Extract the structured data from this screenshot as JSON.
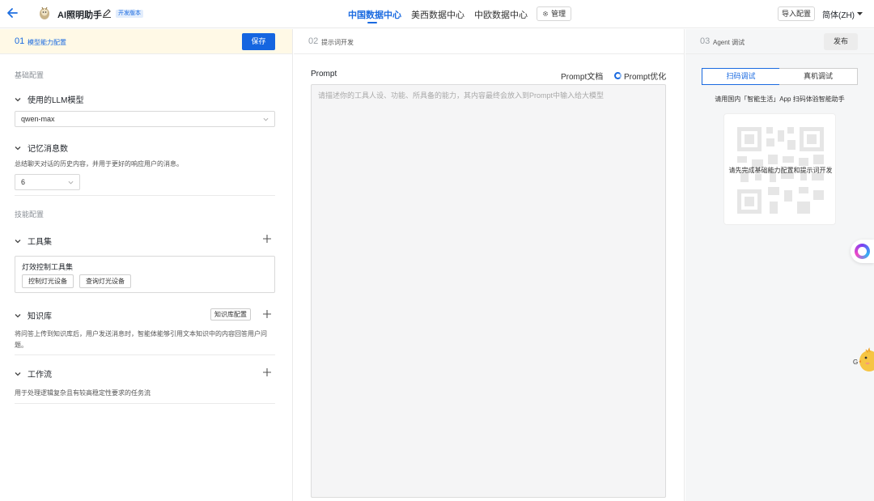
{
  "header": {
    "app_name": "AI照明助手",
    "badge": "开发版本",
    "tabs": [
      {
        "label": "中国数据中心",
        "active": true
      },
      {
        "label": "美西数据中心",
        "active": false
      },
      {
        "label": "中欧数据中心",
        "active": false
      }
    ],
    "manage_label": "管理",
    "import_label": "导入配置",
    "language": "简体(ZH)",
    "accent_color": "#1a6ae0"
  },
  "left": {
    "step": "01",
    "title": "模型能力配置",
    "save_label": "保存",
    "basic_section": "基础配置",
    "llm_label": "使用的LLM模型",
    "llm_value": "qwen-max",
    "memory_label": "记忆消息数",
    "memory_hint": "总结聊天对话的历史内容，并用于更好的响应用户的消息。",
    "memory_value": "6",
    "skill_section": "技能配置",
    "toolset_label": "工具集",
    "toolset_name": "灯效控制工具集",
    "tools": [
      "控制灯光设备",
      "查询灯光设备"
    ],
    "kb_label": "知识库",
    "kb_config_label": "知识库配置",
    "kb_hint_1": "将问答上传到知识库后，用户发送消息时，智能体能够引用文本知识中的内容回答用户问",
    "kb_hint_2": "题。",
    "workflow_label": "工作流",
    "workflow_hint": "用于处理逻辑复杂且有较高稳定性要求的任务流"
  },
  "middle": {
    "step": "02",
    "title": "提示词开发",
    "prompt_label": "Prompt",
    "prompt_doc": "Prompt文档",
    "prompt_optimize": "Prompt优化",
    "prompt_placeholder": "请描述你的工具人设、功能、所具备的能力，其内容最终会放入到Prompt中输入给大模型",
    "prompt_value": ""
  },
  "right": {
    "step": "03",
    "title": "Agent 调试",
    "publish_label": "发布",
    "seg_scan": "扫码调试",
    "seg_device": "真机调试",
    "scan_hint": "请用国内「智能生活」App 扫码体验智能助手",
    "qr_message": "请先完成基础能力配置和提示词开发"
  },
  "floating": {
    "mascot_letter": "G"
  }
}
